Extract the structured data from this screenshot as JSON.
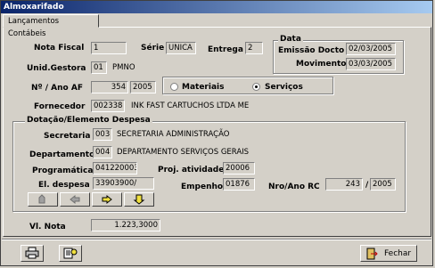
{
  "window": {
    "title": "Almoxarifado"
  },
  "tabs": [
    {
      "label": "Lançamentos Contábeis"
    }
  ],
  "header": {
    "nota_fiscal_label": "Nota Fiscal",
    "nota_fiscal_value": "1",
    "serie_label": "Série",
    "serie_value": "UNICA",
    "entrega_label": "Entrega",
    "entrega_value": "2",
    "unid_gestora_label": "Unid.Gestora",
    "unid_gestora_code": "01",
    "unid_gestora_name": "PMNO",
    "ano_af_label": "Nº / Ano AF",
    "af_number": "354",
    "af_year": "2005",
    "fornecedor_label": "Fornecedor",
    "fornecedor_code": "002338",
    "fornecedor_name": "INK FAST CARTUCHOS LTDA ME"
  },
  "data_group": {
    "title": "Data",
    "emissao_label": "Emissão Docto",
    "emissao_value": "02/03/2005",
    "movimento_label": "Movimento",
    "movimento_value": "03/03/2005"
  },
  "tipo": {
    "options": [
      {
        "label": "Materiais",
        "selected": false
      },
      {
        "label": "Serviços",
        "selected": true
      }
    ]
  },
  "dotacao": {
    "title": "Dotação/Elemento Despesa",
    "secretaria_label": "Secretaria",
    "secretaria_code": "003",
    "secretaria_name": "SECRETARIA ADMINISTRAÇÃO",
    "departamento_label": "Departamento",
    "departamento_code": "004",
    "departamento_name": "DEPARTAMENTO SERVIÇOS GERAIS",
    "programatica_label": "Programática",
    "programatica_value": "041220003",
    "proj_atividade_label": "Proj. atividade",
    "proj_atividade_value": "20006",
    "el_despesa_label": "El. despesa",
    "el_despesa_value": "33903900/",
    "empenho_label": "Empenho",
    "empenho_value": "01876",
    "nro_ano_rc_label": "Nro/Ano RC",
    "rc_number": "243",
    "rc_slash": "/",
    "rc_year": "2005",
    "nav_icons": [
      "first-record-icon",
      "prev-record-icon",
      "next-record-icon",
      "last-record-icon"
    ]
  },
  "vl_nota": {
    "label": "Vl. Nota",
    "value": "1.223,3000"
  },
  "footer": {
    "print_icon": "printer-icon",
    "preview_icon": "report-preview-icon",
    "close_label": "Fechar",
    "close_icon": "exit-door-icon"
  }
}
